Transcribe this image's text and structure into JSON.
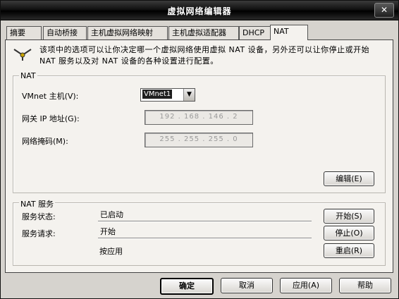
{
  "window": {
    "title": "虚拟网络编辑器",
    "close_label": "✕"
  },
  "tabs": [
    "摘要",
    "自动桥接",
    "主机虚拟网络映射",
    "主机虚拟适配器",
    "DHCP",
    "NAT"
  ],
  "info": {
    "text": "该项中的选项可以让你决定哪一个虚拟网络使用虚拟 NAT 设备，另外还可以让你停止或开始 NAT 服务以及对 NAT 设备的各种设置进行配置。"
  },
  "nat": {
    "legend": "NAT",
    "vmnet_label": "VMnet 主机(V):",
    "vmnet_value": "VMnet1",
    "gateway_label": "网关 IP 地址(G):",
    "gateway_ip": "192 . 168 . 146 .  2",
    "netmask_label": "网络掩码(M):",
    "netmask_ip": "255 . 255 . 255 .  0",
    "edit_button": "编辑(E)"
  },
  "service": {
    "legend": "NAT 服务",
    "status_label": "服务状态:",
    "status_value": "已启动",
    "request_label": "服务请求:",
    "request_value": "开始",
    "applying_value": "按应用",
    "start_button": "开始(S)",
    "stop_button": "停止(O)",
    "restart_button": "重启(R)"
  },
  "footer": {
    "ok": "确定",
    "cancel": "取消",
    "apply": "应用(A)",
    "help": "帮助"
  }
}
